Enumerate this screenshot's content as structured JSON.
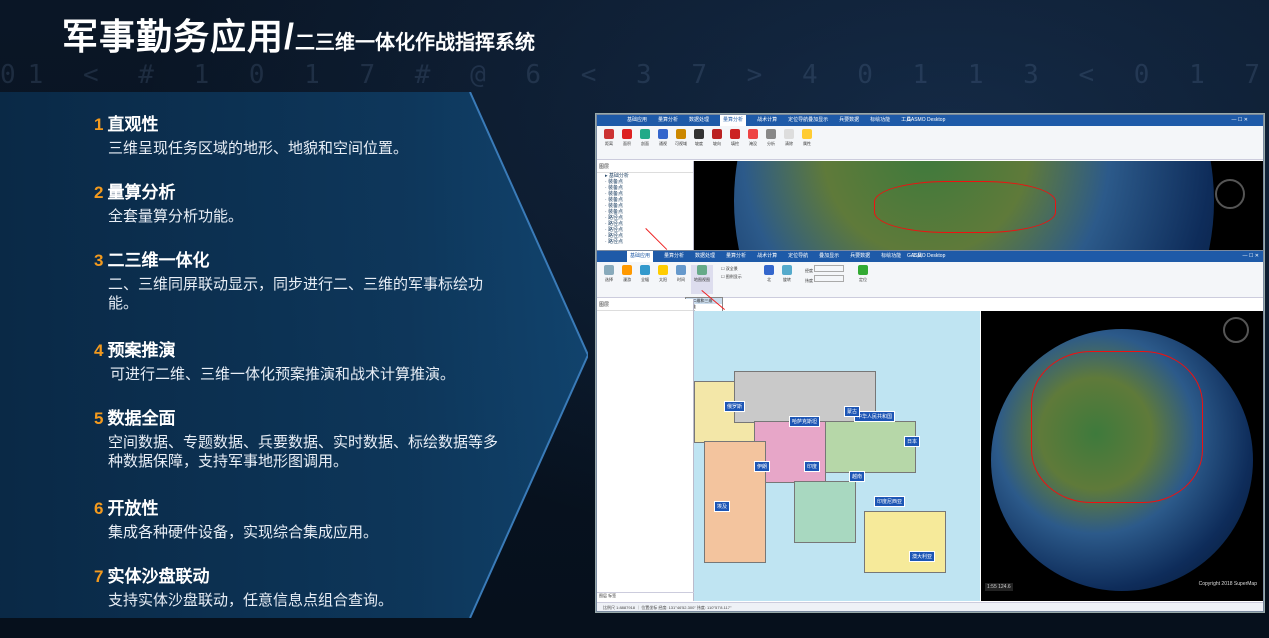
{
  "header": {
    "title_main": "军事勤务应用/",
    "title_sub": "二三维一体化作战指挥系统"
  },
  "features": [
    {
      "num": "1",
      "title": "直观性",
      "desc": "三维呈现任务区域的地形、地貌和空间位置。"
    },
    {
      "num": "2",
      "title": "量算分析",
      "desc": "全套量算分析功能。"
    },
    {
      "num": "3",
      "title": "二三维一体化",
      "desc": "二、三维同屏联动显示，同步进行二、三维的军事标绘功能。"
    },
    {
      "num": "4",
      "title": "预案推演",
      "desc": "可进行二维、三维一体化预案推演和战术计算推演。"
    },
    {
      "num": "5",
      "title": "数据全面",
      "desc": "空间数据、专题数据、兵要数据、实时数据、标绘数据等多种数据保障，支持军事地形图调用。"
    },
    {
      "num": "6",
      "title": "开放性",
      "desc": "集成各种硬件设备，实现综合集成应用。"
    },
    {
      "num": "7",
      "title": "实体沙盘联动",
      "desc": "支持实体沙盘联动，任意信息点组合查询。"
    }
  ],
  "screenshot": {
    "app_title": "GASMO Desktop",
    "scale": "1:55 124.6",
    "copyright": "Copyright 2018 SuperMap"
  },
  "colors": {
    "accent": "#f39a1e",
    "panel": "#0f3a5e",
    "ribbon_blue": "#1e5aa8"
  }
}
